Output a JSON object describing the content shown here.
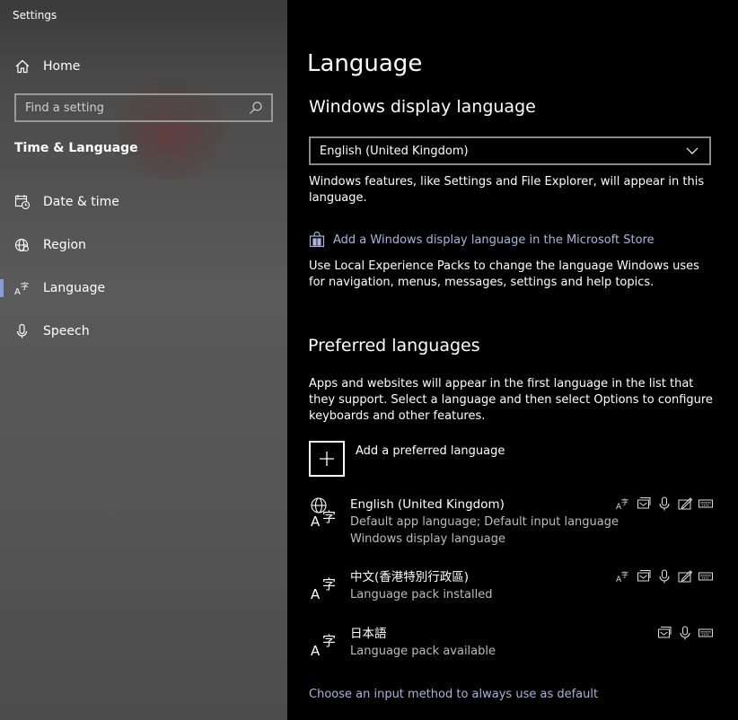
{
  "app": {
    "title": "Settings"
  },
  "sidebar": {
    "home_label": "Home",
    "search_placeholder": "Find a setting",
    "section_title": "Time & Language",
    "items": [
      {
        "label": "Date & time",
        "icon": "calendar-clock-icon"
      },
      {
        "label": "Region",
        "icon": "globe-icon"
      },
      {
        "label": "Language",
        "icon": "language-icon",
        "selected": true
      },
      {
        "label": "Speech",
        "icon": "microphone-icon"
      }
    ]
  },
  "main": {
    "page_title": "Language",
    "display_language": {
      "heading": "Windows display language",
      "selected": "English (United Kingdom)",
      "description": "Windows features, like Settings and File Explorer, will appear in this language.",
      "store_link": "Add a Windows display language in the Microsoft Store",
      "store_description": "Use Local Experience Packs to change the language Windows uses for navigation, menus, messages, settings and help topics."
    },
    "preferred": {
      "heading": "Preferred languages",
      "description": "Apps and websites will appear in the first language in the list that they support. Select a language and then select Options to configure keyboards and other features.",
      "add_label": "Add a preferred language",
      "languages": [
        {
          "name": "English (United Kingdom)",
          "sub1": "Default app language; Default input language",
          "sub2": "Windows display language"
        },
        {
          "name": "中文(香港特別行政區)",
          "sub1": "Language pack installed"
        },
        {
          "name": "日本語",
          "sub1": "Language pack available"
        }
      ]
    },
    "input_method_link": "Choose an input method to always use as default"
  },
  "colors": {
    "accent": "#8a9bd0",
    "link": "#a9b4dd"
  }
}
